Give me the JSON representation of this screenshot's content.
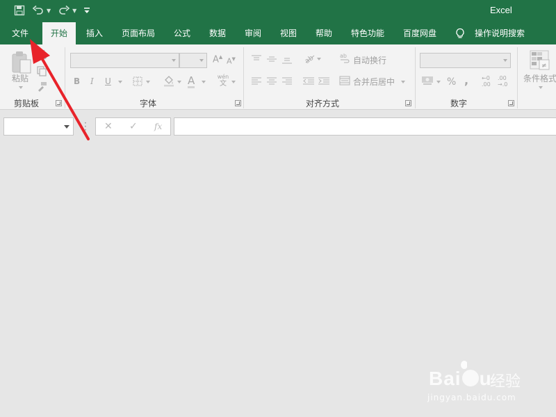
{
  "window": {
    "app_title": "Excel"
  },
  "quick_access": [
    "save-icon",
    "undo-icon",
    "redo-icon",
    "customize-icon"
  ],
  "tabs": [
    {
      "label": "文件",
      "active": false
    },
    {
      "label": "开始",
      "active": true
    },
    {
      "label": "插入",
      "active": false
    },
    {
      "label": "页面布局",
      "active": false
    },
    {
      "label": "公式",
      "active": false
    },
    {
      "label": "数据",
      "active": false
    },
    {
      "label": "审阅",
      "active": false
    },
    {
      "label": "视图",
      "active": false
    },
    {
      "label": "帮助",
      "active": false
    },
    {
      "label": "特色功能",
      "active": false
    },
    {
      "label": "百度网盘",
      "active": false
    }
  ],
  "tell_me": {
    "label": "操作说明搜索",
    "icon": "lightbulb-icon"
  },
  "ribbon": {
    "clipboard": {
      "group_label": "剪贴板",
      "paste_label": "粘贴"
    },
    "font": {
      "group_label": "字体",
      "bold": "B",
      "italic": "I",
      "underline": "U",
      "font_color": "A",
      "phonetic": "wén",
      "phonetic_char": "文"
    },
    "alignment": {
      "group_label": "对齐方式",
      "wrap_text": "自动换行",
      "merge_center": "合并后居中"
    },
    "number": {
      "group_label": "数字",
      "percent": "%",
      "comma": ",",
      "inc_decimal_top": "←0",
      "inc_decimal_bottom": ".00",
      "dec_decimal_top": ".00",
      "dec_decimal_bottom": "→.0"
    },
    "styles": {
      "conditional_format": "条件格式"
    }
  },
  "formula_bar": {
    "cancel": "✕",
    "enter": "✓",
    "fx": "fx",
    "value": ""
  },
  "watermark": {
    "brand": "Bai",
    "brand_end": "u",
    "suffix": "经验",
    "url": "jingyan.baidu.com"
  },
  "colors": {
    "accent": "#217346",
    "annotation": "#e8232a"
  }
}
